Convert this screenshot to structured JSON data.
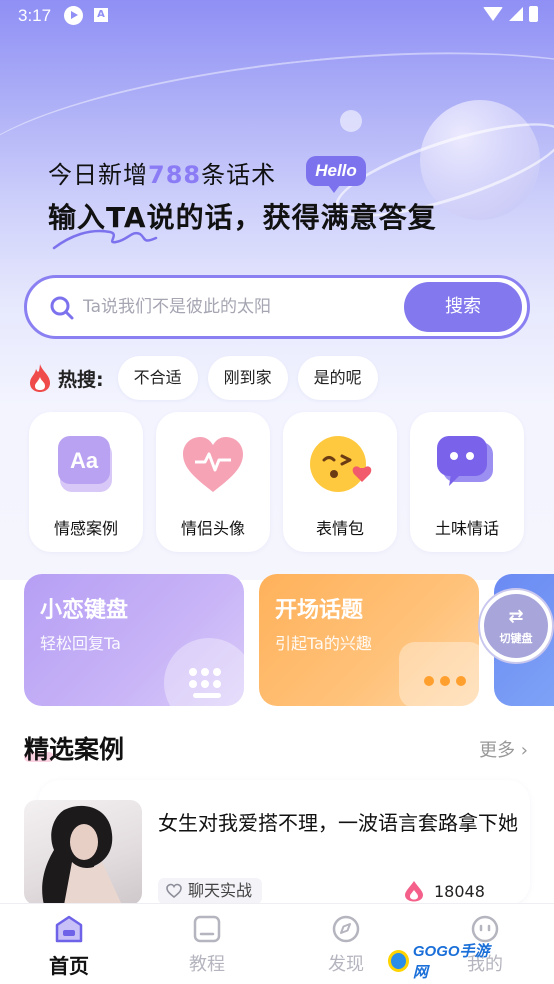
{
  "status_bar": {
    "time": "3:17",
    "notif_letter": "A"
  },
  "hero": {
    "line1_prefix": "今日新增",
    "line1_number": "788",
    "line1_suffix": "条话术",
    "hello_badge": "Hello",
    "line2": "输入TA说的话，获得满意答复"
  },
  "search": {
    "placeholder": "Ta说我们不是彼此的太阳",
    "button_label": "搜索"
  },
  "hot": {
    "label": "热搜:",
    "chips": [
      "不合适",
      "刚到家",
      "是的呢"
    ]
  },
  "categories": [
    {
      "label": "情感案例",
      "icon": "aa-letter-icon"
    },
    {
      "label": "情侣头像",
      "icon": "heart-pulse-icon"
    },
    {
      "label": "表情包",
      "icon": "emoji-face-icon"
    },
    {
      "label": "土味情话",
      "icon": "chat-bubble-icon"
    }
  ],
  "banners": [
    {
      "title": "小恋键盘",
      "subtitle": "轻松回复Ta"
    },
    {
      "title": "开场话题",
      "subtitle": "引起Ta的兴趣"
    }
  ],
  "keyboard_switch": {
    "label": "切键盘"
  },
  "section": {
    "title": "精选案例",
    "more": "更多"
  },
  "case": {
    "title": "女生对我爱搭不理，一波语言套路拿下她",
    "tag": "聊天实战",
    "likes": "18048"
  },
  "tabs": [
    {
      "label": "首页",
      "icon": "home-icon",
      "active": true
    },
    {
      "label": "教程",
      "icon": "book-icon",
      "active": false
    },
    {
      "label": "发现",
      "icon": "compass-icon",
      "active": false
    },
    {
      "label": "我的",
      "icon": "profile-icon",
      "active": false
    }
  ],
  "watermark": {
    "text": "GOGO手游网"
  },
  "colors": {
    "accent": "#8378ee",
    "hero_top": "#8f8ff5",
    "banner_purple": "#b69ff4",
    "banner_orange": "#ffb15a",
    "banner_blue": "#6a8af3"
  }
}
